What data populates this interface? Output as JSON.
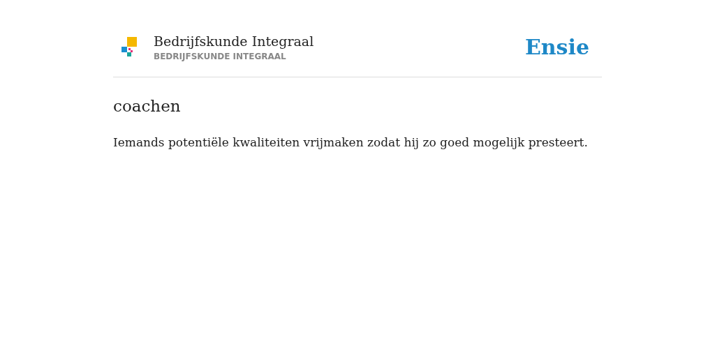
{
  "header": {
    "title": "Bedrijfskunde Integraal",
    "subtitle": "BEDRIJFSKUNDE INTEGRAAL",
    "brand": "Ensie"
  },
  "entry": {
    "term": "coachen",
    "definition": "Iemands potentiële kwaliteiten vrijmaken zodat hij zo goed mogelijk presteert."
  }
}
